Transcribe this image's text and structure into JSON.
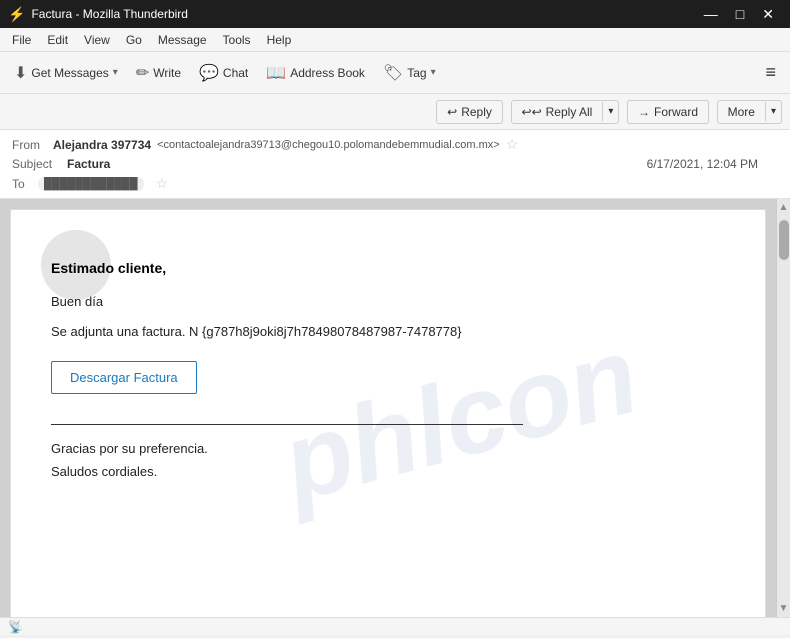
{
  "titleBar": {
    "title": "Factura - Mozilla Thunderbird",
    "icon": "🦤",
    "controls": {
      "minimize": "—",
      "maximize": "□",
      "close": "✕"
    }
  },
  "menuBar": {
    "items": [
      "File",
      "Edit",
      "View",
      "Go",
      "Message",
      "Tools",
      "Help"
    ]
  },
  "toolbar": {
    "getMessages": "Get Messages",
    "write": "Write",
    "chat": "Chat",
    "addressBook": "Address Book",
    "tag": "Tag",
    "hamburger": "≡"
  },
  "actionBar": {
    "reply": "Reply",
    "replyAll": "Reply All",
    "forward": "Forward",
    "more": "More"
  },
  "emailHeader": {
    "fromLabel": "From",
    "fromName": "Alejandra 397734",
    "fromEmail": "<contactoalejandra39713@chegou10.polomandebemmudial.com.mx>",
    "starIcon": "☆",
    "subjectLabel": "Subject",
    "subject": "Factura",
    "date": "6/17/2021, 12:04 PM",
    "toLabel": "To",
    "toAddr": "████████████"
  },
  "emailBody": {
    "greeting": "Estimado cliente,",
    "para1": "Buen día",
    "para2": "Se adjunta una factura. N {g787h8j9oki8j7h78498078487987-7478778}",
    "downloadBtn": "Descargar Factura",
    "closing1": "Gracias por su preferencia.",
    "closing2": "Saludos cordiales."
  },
  "statusBar": {
    "icon": "📡",
    "text": ""
  },
  "watermark": "phlcon"
}
